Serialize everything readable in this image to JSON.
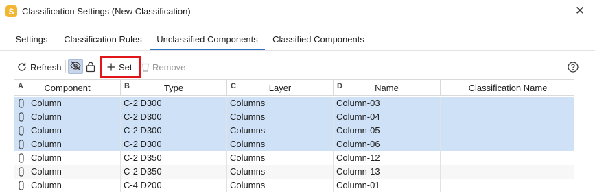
{
  "window": {
    "title": "Classification Settings (New Classification)",
    "app_icon_letter": "S"
  },
  "tabs": [
    {
      "label": "Settings",
      "active": false
    },
    {
      "label": "Classification Rules",
      "active": false
    },
    {
      "label": "Unclassified Components",
      "active": true
    },
    {
      "label": "Classified Components",
      "active": false
    }
  ],
  "toolbar": {
    "refresh_label": "Refresh",
    "set_label": "Set",
    "remove_label": "Remove"
  },
  "table": {
    "columns": [
      {
        "letter": "A",
        "label": "Component"
      },
      {
        "letter": "B",
        "label": "Type"
      },
      {
        "letter": "C",
        "label": "Layer"
      },
      {
        "letter": "D",
        "label": "Name"
      },
      {
        "letter": "",
        "label": "Classification Name"
      }
    ],
    "rows": [
      {
        "component": "Column",
        "type": "C-2 D300",
        "layer": "Columns",
        "name": "Column-03",
        "classification": "",
        "selected": true
      },
      {
        "component": "Column",
        "type": "C-2 D300",
        "layer": "Columns",
        "name": "Column-04",
        "classification": "",
        "selected": true
      },
      {
        "component": "Column",
        "type": "C-2 D300",
        "layer": "Columns",
        "name": "Column-05",
        "classification": "",
        "selected": true
      },
      {
        "component": "Column",
        "type": "C-2 D300",
        "layer": "Columns",
        "name": "Column-06",
        "classification": "",
        "selected": true
      },
      {
        "component": "Column",
        "type": "C-2 D350",
        "layer": "Columns",
        "name": "Column-12",
        "classification": "",
        "selected": false
      },
      {
        "component": "Column",
        "type": "C-2 D350",
        "layer": "Columns",
        "name": "Column-13",
        "classification": "",
        "selected": false
      },
      {
        "component": "Column",
        "type": "C-4 D200",
        "layer": "Columns",
        "name": "Column-01",
        "classification": "",
        "selected": false
      }
    ]
  },
  "colors": {
    "selection": "#cfe1f7",
    "accent": "#2f6fbf",
    "highlight_box": "#e0161b",
    "app_icon": "#f2b632"
  }
}
